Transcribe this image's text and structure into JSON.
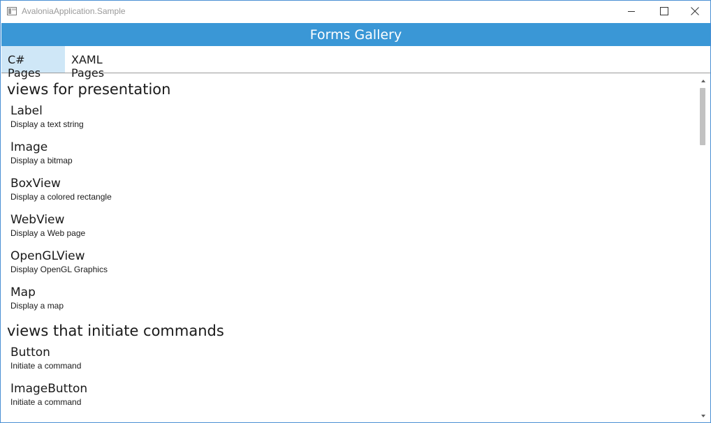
{
  "window": {
    "title": "AvaloniaApplication.Sample"
  },
  "header": {
    "title": "Forms Gallery"
  },
  "tabs": [
    {
      "label": "C# Pages",
      "selected": true
    },
    {
      "label": "XAML Pages",
      "selected": false
    }
  ],
  "sections": [
    {
      "heading": "views for presentation",
      "items": [
        {
          "title": "Label",
          "description": "Display a text string"
        },
        {
          "title": "Image",
          "description": "Display a bitmap"
        },
        {
          "title": "BoxView",
          "description": "Display a colored rectangle"
        },
        {
          "title": "WebView",
          "description": "Display a Web page"
        },
        {
          "title": "OpenGLView",
          "description": "Display OpenGL Graphics"
        },
        {
          "title": "Map",
          "description": "Display a map"
        }
      ]
    },
    {
      "heading": "views that initiate commands",
      "items": [
        {
          "title": "Button",
          "description": "Initiate a command"
        },
        {
          "title": "ImageButton",
          "description": "Initiate a command"
        }
      ]
    }
  ],
  "colors": {
    "header_bg": "#3a97d6",
    "selected_tab_bg": "#cfe7f7",
    "window_border": "#4a8fd4"
  },
  "icons": {
    "app": "app-window-icon",
    "minimize": "minimize-icon",
    "maximize": "maximize-icon",
    "close": "close-icon"
  }
}
